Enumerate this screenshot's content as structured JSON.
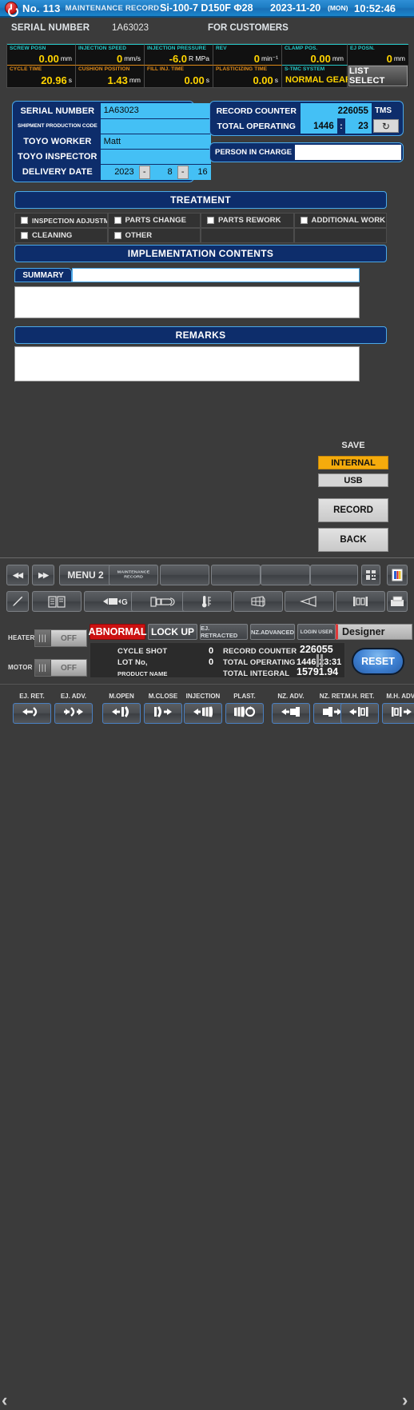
{
  "titlebar": {
    "power_icon": "power-icon",
    "no": "No. 113",
    "subtitle": "MAINTENANCE RECORD",
    "machine": "Si-100-7  D150F  Φ28",
    "date": "2023-11-20",
    "day": "(MON)",
    "time": "10:52:46"
  },
  "serial_row": {
    "label": "SERIAL NUMBER",
    "value": "1A63023",
    "for_customers": "FOR CUSTOMERS"
  },
  "data_panel": {
    "row1": [
      {
        "cap": "SCREW POSN",
        "value": "0.00",
        "unit": "mm"
      },
      {
        "cap": "INJECTION SPEED",
        "value": "0",
        "unit": "mm/s"
      },
      {
        "cap": "INJECTION PRESSURE",
        "value": "-6.0",
        "unit": "R MPa"
      },
      {
        "cap": "REV",
        "value": "0",
        "unit": "min⁻¹"
      },
      {
        "cap": "CLAMP POS.",
        "value": "0.00",
        "unit": "mm"
      },
      {
        "cap": "EJ POSN.",
        "value": "0",
        "unit": "mm"
      }
    ],
    "row2": [
      {
        "cap": "CYCLE TIME",
        "value": "20.96",
        "unit": "s"
      },
      {
        "cap": "CUSHION POSITION",
        "value": "1.43",
        "unit": "mm"
      },
      {
        "cap": "FILL INJ. TIME",
        "value": "0.00",
        "unit": "s"
      },
      {
        "cap": "PLASTICIZING TIME",
        "value": "0.00",
        "unit": "s"
      },
      {
        "cap": "S-TMC SYSTEM",
        "value": "NORMAL GEAR",
        "unit": ""
      }
    ],
    "list_select_label": "LIST SELECT"
  },
  "form_left": {
    "serial_number_label": "SERIAL NUMBER",
    "serial_number_value": "1A63023",
    "shipment_code_label": "SHIPMENT PRODUCTION CODE",
    "shipment_code_value": "",
    "toyo_worker_label": "TOYO WORKER",
    "toyo_worker_value": "Matt",
    "toyo_inspector_label": "TOYO INSPECTOR",
    "toyo_inspector_value": "",
    "delivery_date_label": "DELIVERY DATE",
    "delivery_year": "2023",
    "delivery_month": "8",
    "delivery_day": "16",
    "date_sep": "-"
  },
  "form_right": {
    "record_counter_label": "RECORD COUNTER",
    "record_counter_value": "226055",
    "tms_label": "TMS",
    "total_operating_label": "TOTAL OPERATING",
    "total_operating_hours": "1446",
    "total_operating_minutes": "23",
    "time_sep": ":",
    "refresh_icon": "refresh-icon",
    "person_in_charge_label": "PERSON IN CHARGE",
    "person_in_charge_value": ""
  },
  "sections": {
    "treatment": "TREATMENT",
    "implementation_contents": "IMPLEMENTATION CONTENTS",
    "summary": "SUMMARY",
    "remarks": "REMARKS"
  },
  "checkboxes": [
    {
      "label": "INSPECTION ADJUSTMENT",
      "checked": false,
      "small": true
    },
    {
      "label": "PARTS CHANGE",
      "checked": false,
      "small": false
    },
    {
      "label": "PARTS REWORK",
      "checked": false,
      "small": false
    },
    {
      "label": "ADDITIONAL WORK",
      "checked": false,
      "small": false
    },
    {
      "label": "CLEANING",
      "checked": false,
      "small": false
    },
    {
      "label": "OTHER",
      "checked": false,
      "small": false
    },
    {
      "label": "",
      "checked": false,
      "small": false
    },
    {
      "label": "",
      "checked": false,
      "small": false
    }
  ],
  "text_areas": {
    "summary_line": "",
    "summary_body": "",
    "remarks_body": ""
  },
  "save_panel": {
    "title": "SAVE",
    "internal": "INTERNAL",
    "usb": "USB",
    "record": "RECORD",
    "back": "BACK",
    "accent_color": "#f5ab0c"
  },
  "toolbar_row1": [
    {
      "name": "prev-page-button",
      "label": "◀◀",
      "kind": "glyph"
    },
    {
      "name": "next-page-button",
      "label": "▶▶",
      "kind": "glyph"
    },
    {
      "name": "menu2-button",
      "label": "MENU 2",
      "kind": "text"
    },
    {
      "name": "maintenance-record-button",
      "label": "MAINTENANCE RECORD",
      "kind": "tiny"
    },
    {
      "name": "toolbar-blank-1",
      "label": "",
      "kind": "blank"
    },
    {
      "name": "toolbar-blank-2",
      "label": "",
      "kind": "blank"
    },
    {
      "name": "toolbar-blank-3",
      "label": "",
      "kind": "blank"
    },
    {
      "name": "toolbar-blank-4",
      "label": "",
      "kind": "blank"
    },
    {
      "name": "grid-view-icon",
      "label": "",
      "kind": "icon"
    },
    {
      "name": "color-palette-icon",
      "label": "",
      "kind": "icon"
    }
  ],
  "toolbar_row2": [
    {
      "name": "pencil-edit-icon",
      "label": ""
    },
    {
      "name": "book-manual-icon",
      "label": ""
    },
    {
      "name": "gate-g-icon",
      "label": ""
    },
    {
      "name": "mold-profile-icon",
      "label": ""
    },
    {
      "name": "thermometer-icon",
      "label": ""
    },
    {
      "name": "barrel-grid-icon",
      "label": ""
    },
    {
      "name": "nozzle-cone-icon",
      "label": ""
    },
    {
      "name": "clamp-unit-icon",
      "label": ""
    },
    {
      "name": "save-disk-icon",
      "label": ""
    }
  ],
  "status": {
    "heater_label": "HEATER",
    "heater_state": "OFF",
    "motor_label": "MOTOR",
    "motor_state": "OFF",
    "abnormal": "ABNORMAL",
    "lock_up": "LOCK UP",
    "ej_retracted": "EJ. RETRACTED",
    "nz_advanced": "NZ.ADVANCED",
    "login_user_label": "LOGIN USER",
    "login_user_value": "Designer",
    "cycle_shot_label": "CYCLE SHOT",
    "cycle_shot_value": "0",
    "lot_no_label": "LOT No,",
    "lot_no_value": "0",
    "product_name_label": "PRODUCT NAME",
    "record_counter_label": "RECORD COUNTER",
    "record_counter_value": "226055",
    "total_operating_label": "TOTAL OPERATING",
    "total_operating_value": "1446:23:31",
    "total_integral_label": "TOTAL INTEGRAL",
    "total_integral_value": "15791.94",
    "reset_label": "RESET",
    "abnormal_color": "#cc1111"
  },
  "bottom_bar": {
    "left_arrow": "‹",
    "right_arrow": "›",
    "buttons": [
      {
        "label": "EJ. RET.",
        "icon": "ejector-retract-icon"
      },
      {
        "label": "EJ. ADV.",
        "icon": "ejector-advance-icon"
      },
      {
        "label": "M.OPEN",
        "icon": "mold-open-icon"
      },
      {
        "label": "M.CLOSE",
        "icon": "mold-close-icon"
      },
      {
        "label": "INJECTION",
        "icon": "injection-icon"
      },
      {
        "label": "PLAST.",
        "icon": "plasticizing-icon"
      },
      {
        "label": "NZ. ADV.",
        "icon": "nozzle-advance-icon"
      },
      {
        "label": "NZ. RET.",
        "icon": "nozzle-retract-icon"
      },
      {
        "label": "M.H. RET.",
        "icon": "mold-height-retract-icon"
      },
      {
        "label": "M.H. ADV.",
        "icon": "mold-height-advance-icon"
      }
    ]
  }
}
